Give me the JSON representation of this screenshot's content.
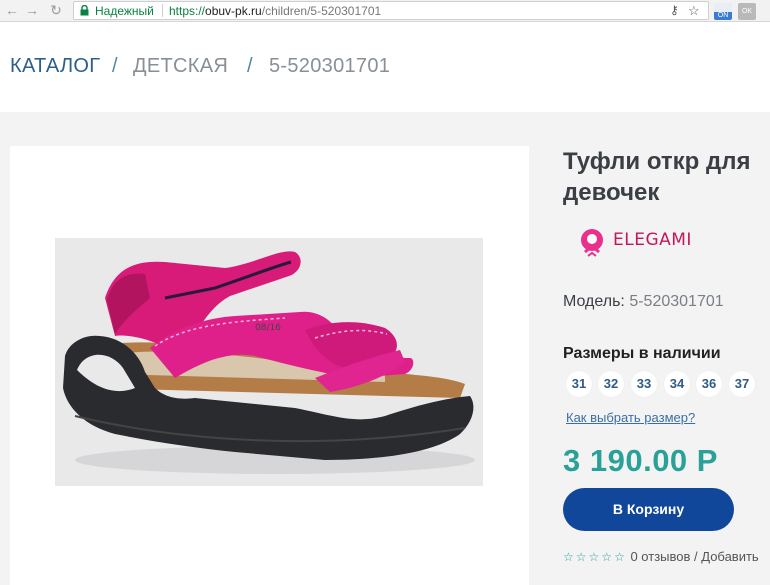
{
  "browser": {
    "secure_label": "Надежный",
    "url_scheme": "https://",
    "url_host": "obuv-pk.ru",
    "url_path": "/children/5-520301701",
    "ext1_label": "ON",
    "ext2_label": "OK"
  },
  "breadcrumb": {
    "items": [
      "КАТАЛОГ",
      "ДЕТСКАЯ",
      "5-520301701"
    ],
    "separator": "/"
  },
  "product": {
    "title_line1": "Туфли откр для",
    "title_line2": "девочек",
    "brand": "ELEGAMI",
    "model_label": "Модель:",
    "model_value": "5-520301701",
    "sizes_title": "Размеры в наличии",
    "sizes": [
      "31",
      "32",
      "33",
      "34",
      "36",
      "37"
    ],
    "size_guide_link": "Как выбрать размер?",
    "price": "3 190.00 Р",
    "cart_button": "В Корзину",
    "reviews_text": "0 отзывов /",
    "add_review_text": "Добавить",
    "rating": 0,
    "rating_max": 5,
    "image_label": "08/16"
  },
  "colors": {
    "accent": "#2aa198",
    "button": "#11479a",
    "brand": "#c2185b",
    "breadcrumb": "#2c5f8a"
  }
}
